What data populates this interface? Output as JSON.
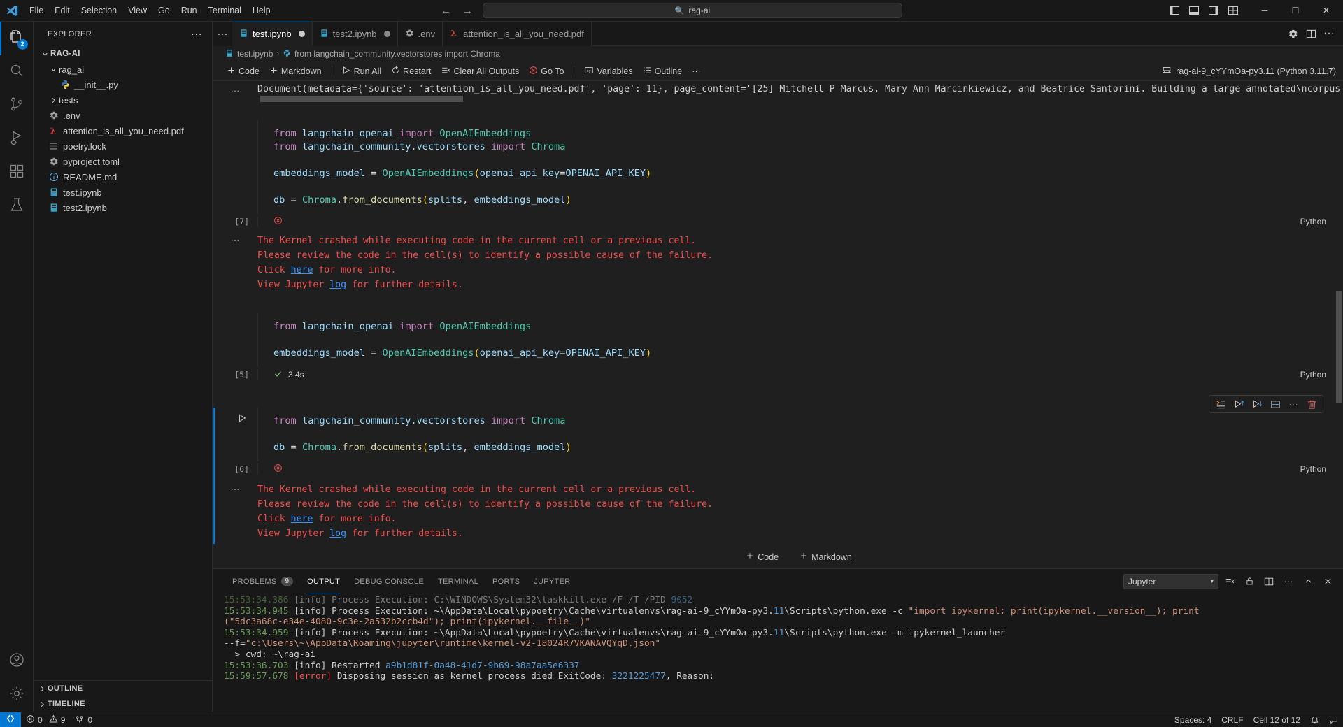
{
  "titlebar": {
    "menus": [
      "File",
      "Edit",
      "Selection",
      "View",
      "Go",
      "Run",
      "Terminal",
      "Help"
    ],
    "command_center_text": "rag-ai",
    "search_icon": "magnifier-icon",
    "back_icon": "arrow-left-icon",
    "forward_icon": "arrow-right-icon",
    "window_minimize": "─",
    "window_maximize": "☐",
    "window_close": "✕"
  },
  "activitybar": {
    "items": [
      {
        "name": "explorer",
        "icon": "files-icon",
        "badge": "2",
        "active": true
      },
      {
        "name": "search",
        "icon": "search-icon",
        "badge": ""
      },
      {
        "name": "source-control",
        "icon": "source-control-icon",
        "badge": ""
      },
      {
        "name": "run-and-debug",
        "icon": "run-debug-icon",
        "badge": ""
      },
      {
        "name": "extensions",
        "icon": "extensions-icon",
        "badge": ""
      },
      {
        "name": "testing",
        "icon": "beaker-icon",
        "badge": ""
      }
    ],
    "bottom": [
      {
        "name": "accounts",
        "icon": "account-icon"
      },
      {
        "name": "manage",
        "icon": "gear-icon"
      }
    ]
  },
  "sidebar": {
    "title": "EXPLORER",
    "more_actions": "···",
    "root": {
      "label": "RAG-AI",
      "expanded": true
    },
    "tree": [
      {
        "label": "rag_ai",
        "icon": "folder-icon",
        "indent": 1,
        "expandable": true,
        "expanded": true
      },
      {
        "label": "__init__.py",
        "icon": "python-icon",
        "indent": 2,
        "expandable": false
      },
      {
        "label": "tests",
        "icon": "folder-icon",
        "indent": 1,
        "expandable": true,
        "expanded": false
      },
      {
        "label": ".env",
        "icon": "gear-icon",
        "indent": 1,
        "expandable": false
      },
      {
        "label": "attention_is_all_you_need.pdf",
        "icon": "pdf-icon",
        "indent": 1,
        "expandable": false
      },
      {
        "label": "poetry.lock",
        "icon": "lock-file-icon",
        "indent": 1,
        "expandable": false
      },
      {
        "label": "pyproject.toml",
        "icon": "gear-icon",
        "indent": 1,
        "expandable": false
      },
      {
        "label": "README.md",
        "icon": "info-icon",
        "indent": 1,
        "expandable": false
      },
      {
        "label": "test.ipynb",
        "icon": "notebook-icon",
        "indent": 1,
        "expandable": false
      },
      {
        "label": "test2.ipynb",
        "icon": "notebook-icon",
        "indent": 1,
        "expandable": false
      }
    ],
    "sections": [
      {
        "label": "OUTLINE"
      },
      {
        "label": "TIMELINE"
      }
    ]
  },
  "tabs": {
    "overflow_icon": "···",
    "items": [
      {
        "label": "test.ipynb",
        "icon": "notebook-icon",
        "active": true,
        "dirty": true,
        "dirty_dim": false
      },
      {
        "label": "test2.ipynb",
        "icon": "notebook-icon",
        "active": false,
        "dirty": true,
        "dirty_dim": true
      },
      {
        "label": ".env",
        "icon": "gear-icon",
        "active": false,
        "dirty": false,
        "dirty_dim": false
      },
      {
        "label": "attention_is_all_you_need.pdf",
        "icon": "pdf-icon",
        "active": false,
        "dirty": false,
        "dirty_dim": false
      }
    ],
    "actions": [
      "settings-gear-icon",
      "split-editor-icon",
      "more-actions-icon"
    ]
  },
  "breadcrumbs": {
    "file": "test.ipynb",
    "separator": "›",
    "symbol": "from langchain_community.vectorstores import Chroma"
  },
  "notebook_toolbar": {
    "buttons": [
      {
        "label": "Code",
        "icon": "plus-icon"
      },
      {
        "label": "Markdown",
        "icon": "plus-icon"
      },
      {
        "label": "Run All",
        "icon": "run-all-icon"
      },
      {
        "label": "Restart",
        "icon": "restart-icon"
      },
      {
        "label": "Clear All Outputs",
        "icon": "clear-outputs-icon"
      },
      {
        "label": "Go To",
        "icon": "error-circle-icon"
      },
      {
        "label": "Variables",
        "icon": "variables-icon"
      },
      {
        "label": "Outline",
        "icon": "outline-icon"
      },
      {
        "label": "···",
        "icon": "more-icon"
      }
    ],
    "kernel": {
      "label": "rag-ai-9_cYYmOa-py3.11 (Python 3.11.7)",
      "icon": "kernel-icon"
    }
  },
  "notebook": {
    "top_output": {
      "gutter": "···",
      "text": "Document(metadata={'source': 'attention_is_all_you_need.pdf', 'page': 11}, page_content='[25] Mitchell P Marcus, Mary Ann Marcinkiewicz, and Beatrice Santorini. Building a large annotated\\ncorpus of en"
    },
    "cells": [
      {
        "exec_count": "[7]",
        "language": "Python",
        "status_icon": "error-circle-icon",
        "status_text": "",
        "focused": false,
        "lines": [
          [
            {
              "t": "kw",
              "v": "from "
            },
            {
              "t": "id",
              "v": "langchain_openai"
            },
            {
              "t": "kw",
              "v": " import "
            },
            {
              "t": "cls",
              "v": "OpenAIEmbeddings"
            }
          ],
          [
            {
              "t": "kw",
              "v": "from "
            },
            {
              "t": "id",
              "v": "langchain_community.vectorstores"
            },
            {
              "t": "kw",
              "v": " import "
            },
            {
              "t": "cls",
              "v": "Chroma"
            }
          ],
          [],
          [
            {
              "t": "id",
              "v": "embeddings_model"
            },
            {
              "t": "op",
              "v": " = "
            },
            {
              "t": "cls",
              "v": "OpenAIEmbeddings"
            },
            {
              "t": "par",
              "v": "("
            },
            {
              "t": "id",
              "v": "openai_api_key"
            },
            {
              "t": "op",
              "v": "="
            },
            {
              "t": "id",
              "v": "OPENAI_API_KEY"
            },
            {
              "t": "par",
              "v": ")"
            }
          ],
          [],
          [
            {
              "t": "id",
              "v": "db"
            },
            {
              "t": "op",
              "v": " = "
            },
            {
              "t": "cls",
              "v": "Chroma"
            },
            {
              "t": "op",
              "v": "."
            },
            {
              "t": "fn",
              "v": "from_documents"
            },
            {
              "t": "par",
              "v": "("
            },
            {
              "t": "id",
              "v": "splits"
            },
            {
              "t": "plain",
              "v": ", "
            },
            {
              "t": "id",
              "v": "embeddings_model"
            },
            {
              "t": "par",
              "v": ")"
            }
          ]
        ],
        "error": {
          "gutter": "···",
          "line1": "The Kernel crashed while executing code in the current cell or a previous cell.",
          "line2": "Please review the code in the cell(s) to identify a possible cause of the failure.",
          "line3_pre": "Click ",
          "line3_link": "here",
          "line3_post": " for more info.",
          "line4_pre": "View Jupyter ",
          "line4_link": "log",
          "line4_post": " for further details."
        }
      },
      {
        "exec_count": "[5]",
        "language": "Python",
        "status_icon": "check-icon",
        "status_text": "3.4s",
        "focused": false,
        "lines": [
          [
            {
              "t": "kw",
              "v": "from "
            },
            {
              "t": "id",
              "v": "langchain_openai"
            },
            {
              "t": "kw",
              "v": " import "
            },
            {
              "t": "cls",
              "v": "OpenAIEmbeddings"
            }
          ],
          [],
          [
            {
              "t": "id",
              "v": "embeddings_model"
            },
            {
              "t": "op",
              "v": " = "
            },
            {
              "t": "cls",
              "v": "OpenAIEmbeddings"
            },
            {
              "t": "par",
              "v": "("
            },
            {
              "t": "id",
              "v": "openai_api_key"
            },
            {
              "t": "op",
              "v": "="
            },
            {
              "t": "id",
              "v": "OPENAI_API_KEY"
            },
            {
              "t": "par",
              "v": ")"
            }
          ]
        ],
        "error": null
      },
      {
        "exec_count": "[6]",
        "language": "Python",
        "status_icon": "error-circle-icon",
        "status_text": "",
        "focused": true,
        "toolbar_icons": [
          "run-by-line-icon",
          "run-above-icon",
          "run-below-icon",
          "split-cell-icon",
          "more-icon",
          "delete-icon"
        ],
        "lines": [
          [
            {
              "t": "kw",
              "v": "from "
            },
            {
              "t": "id",
              "v": "langchain_community.vectorstores"
            },
            {
              "t": "kw",
              "v": " import "
            },
            {
              "t": "cls",
              "v": "Chroma"
            }
          ],
          [],
          [
            {
              "t": "id",
              "v": "db"
            },
            {
              "t": "op",
              "v": " = "
            },
            {
              "t": "cls",
              "v": "Chroma"
            },
            {
              "t": "op",
              "v": "."
            },
            {
              "t": "fn",
              "v": "from_documents"
            },
            {
              "t": "par",
              "v": "("
            },
            {
              "t": "id",
              "v": "splits"
            },
            {
              "t": "plain",
              "v": ", "
            },
            {
              "t": "id",
              "v": "embeddings_model"
            },
            {
              "t": "par",
              "v": ")"
            }
          ]
        ],
        "error": {
          "gutter": "···",
          "line1": "The Kernel crashed while executing code in the current cell or a previous cell.",
          "line2": "Please review the code in the cell(s) to identify a possible cause of the failure.",
          "line3_pre": "Click ",
          "line3_link": "here",
          "line3_post": " for more info.",
          "line4_pre": "View Jupyter ",
          "line4_link": "log",
          "line4_post": " for further details."
        }
      }
    ],
    "add_buttons": [
      {
        "label": "Code",
        "icon": "plus-icon"
      },
      {
        "label": "Markdown",
        "icon": "plus-icon"
      }
    ]
  },
  "panel": {
    "tabs": [
      {
        "label": "PROBLEMS",
        "count": "9",
        "active": false
      },
      {
        "label": "OUTPUT",
        "count": "",
        "active": true
      },
      {
        "label": "DEBUG CONSOLE",
        "count": "",
        "active": false
      },
      {
        "label": "TERMINAL",
        "count": "",
        "active": false
      },
      {
        "label": "PORTS",
        "count": "",
        "active": false
      },
      {
        "label": "JUPYTER",
        "count": "",
        "active": false
      }
    ],
    "channel_select": {
      "value": "Jupyter",
      "chevron": "▾"
    },
    "actions": [
      "clear-output-icon",
      "lock-scroll-icon",
      "split-panel-icon",
      "more-actions-icon",
      "chevron-up-icon",
      "close-icon"
    ],
    "log_lines": [
      {
        "segments": [
          {
            "c": "time",
            "v": "15:53:34.386 "
          },
          {
            "c": "info",
            "v": "[info] Process Execution: C:\\WINDOWS\\System32\\taskkill.exe /F /T /PID "
          },
          {
            "c": "num",
            "v": "9052"
          }
        ]
      },
      {
        "segments": [
          {
            "c": "time",
            "v": "15:53:34.945 "
          },
          {
            "c": "info",
            "v": "[info] Process Execution: ~\\AppData\\Local\\pypoetry\\Cache\\virtualenvs\\rag-ai-9_cYYmOa-py3."
          },
          {
            "c": "num",
            "v": "11"
          },
          {
            "c": "info",
            "v": "\\Scripts\\python.exe -c "
          },
          {
            "c": "str",
            "v": "\"import ipykernel; print(ipykernel.__version__); print"
          }
        ]
      },
      {
        "segments": [
          {
            "c": "str",
            "v": "(\"5dc3a68c-e34e-4080-9c3e-2a532b2ccb4d\"); print(ipykernel.__file__)\""
          }
        ]
      },
      {
        "segments": [
          {
            "c": "time",
            "v": "15:53:34.959 "
          },
          {
            "c": "info",
            "v": "[info] Process Execution: ~\\AppData\\Local\\pypoetry\\Cache\\virtualenvs\\rag-ai-9_cYYmOa-py3."
          },
          {
            "c": "num",
            "v": "11"
          },
          {
            "c": "info",
            "v": "\\Scripts\\python.exe -m ipykernel_launcher"
          }
        ]
      },
      {
        "segments": [
          {
            "c": "info",
            "v": "--f="
          },
          {
            "c": "str",
            "v": "\"c:\\Users\\~\\AppData\\Roaming\\jupyter\\runtime\\kernel-v2-18024R7VKANAVQYqD.json\""
          }
        ]
      },
      {
        "segments": [
          {
            "c": "info",
            "v": "  > cwd: ~\\rag-ai"
          }
        ]
      },
      {
        "segments": [
          {
            "c": "time",
            "v": "15:53:36.703 "
          },
          {
            "c": "info",
            "v": "[info] Restarted "
          },
          {
            "c": "num",
            "v": "a9b1d81f-0a48-41d7-9b69-98a7aa5e6337"
          }
        ]
      },
      {
        "segments": [
          {
            "c": "time",
            "v": "15:59:57.678 "
          },
          {
            "c": "error",
            "v": "[error] "
          },
          {
            "c": "info",
            "v": "Disposing session as kernel process died ExitCode: "
          },
          {
            "c": "num",
            "v": "3221225477"
          },
          {
            "c": "info",
            "v": ", Reason: "
          }
        ]
      }
    ]
  },
  "statusbar": {
    "remote_icon": "remote-icon",
    "errors": "0",
    "warnings": "9",
    "ports": "0",
    "error_icon": "error-icon",
    "warning_icon": "warning-icon",
    "ports_icon": "ports-icon",
    "right_items": [
      {
        "label": "Spaces: 4"
      },
      {
        "label": "CRLF"
      },
      {
        "label": "Cell 12 of 12"
      }
    ],
    "bell_icon": "bell-icon",
    "feedback_icon": "feedback-icon"
  },
  "colors": {
    "accent": "#0078d4",
    "error": "#f14c4c",
    "link": "#3794ff",
    "success": "#89d185",
    "bg": "#1f1f1f",
    "bg_dark": "#181818"
  }
}
